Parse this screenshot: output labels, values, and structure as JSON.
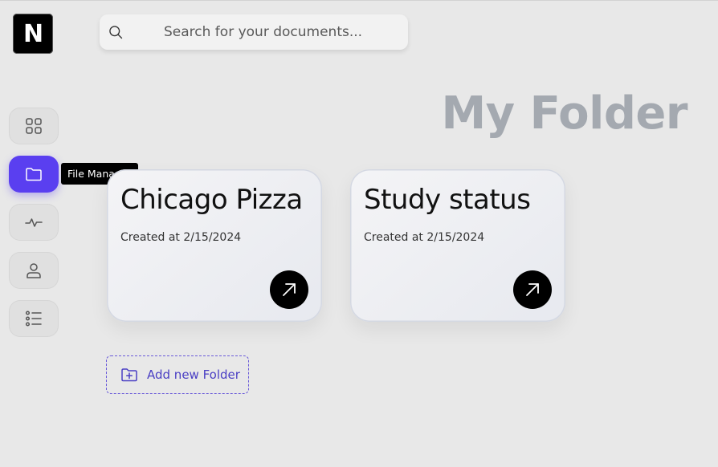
{
  "app": {
    "logo_letter": "N"
  },
  "search": {
    "placeholder": "Search for your documents..."
  },
  "sidebar": {
    "items": [
      {
        "name": "dashboard",
        "icon": "grid-icon",
        "active": false
      },
      {
        "name": "file-manager",
        "icon": "folder-icon",
        "active": true
      },
      {
        "name": "activity",
        "icon": "activity-icon",
        "active": false
      },
      {
        "name": "profile",
        "icon": "user-icon",
        "active": false
      },
      {
        "name": "list",
        "icon": "list-icon",
        "active": false
      }
    ],
    "tooltip": "File Manager"
  },
  "main": {
    "title": "My Folder",
    "folders": [
      {
        "title": "Chicago Pizza",
        "created": "Created at 2/15/2024"
      },
      {
        "title": "Study status",
        "created": "Created at 2/15/2024"
      }
    ],
    "add_folder_label": "Add new Folder"
  },
  "colors": {
    "accent": "#5a3ff0",
    "title": "#a4a9b0",
    "background": "#e8e8e8"
  }
}
